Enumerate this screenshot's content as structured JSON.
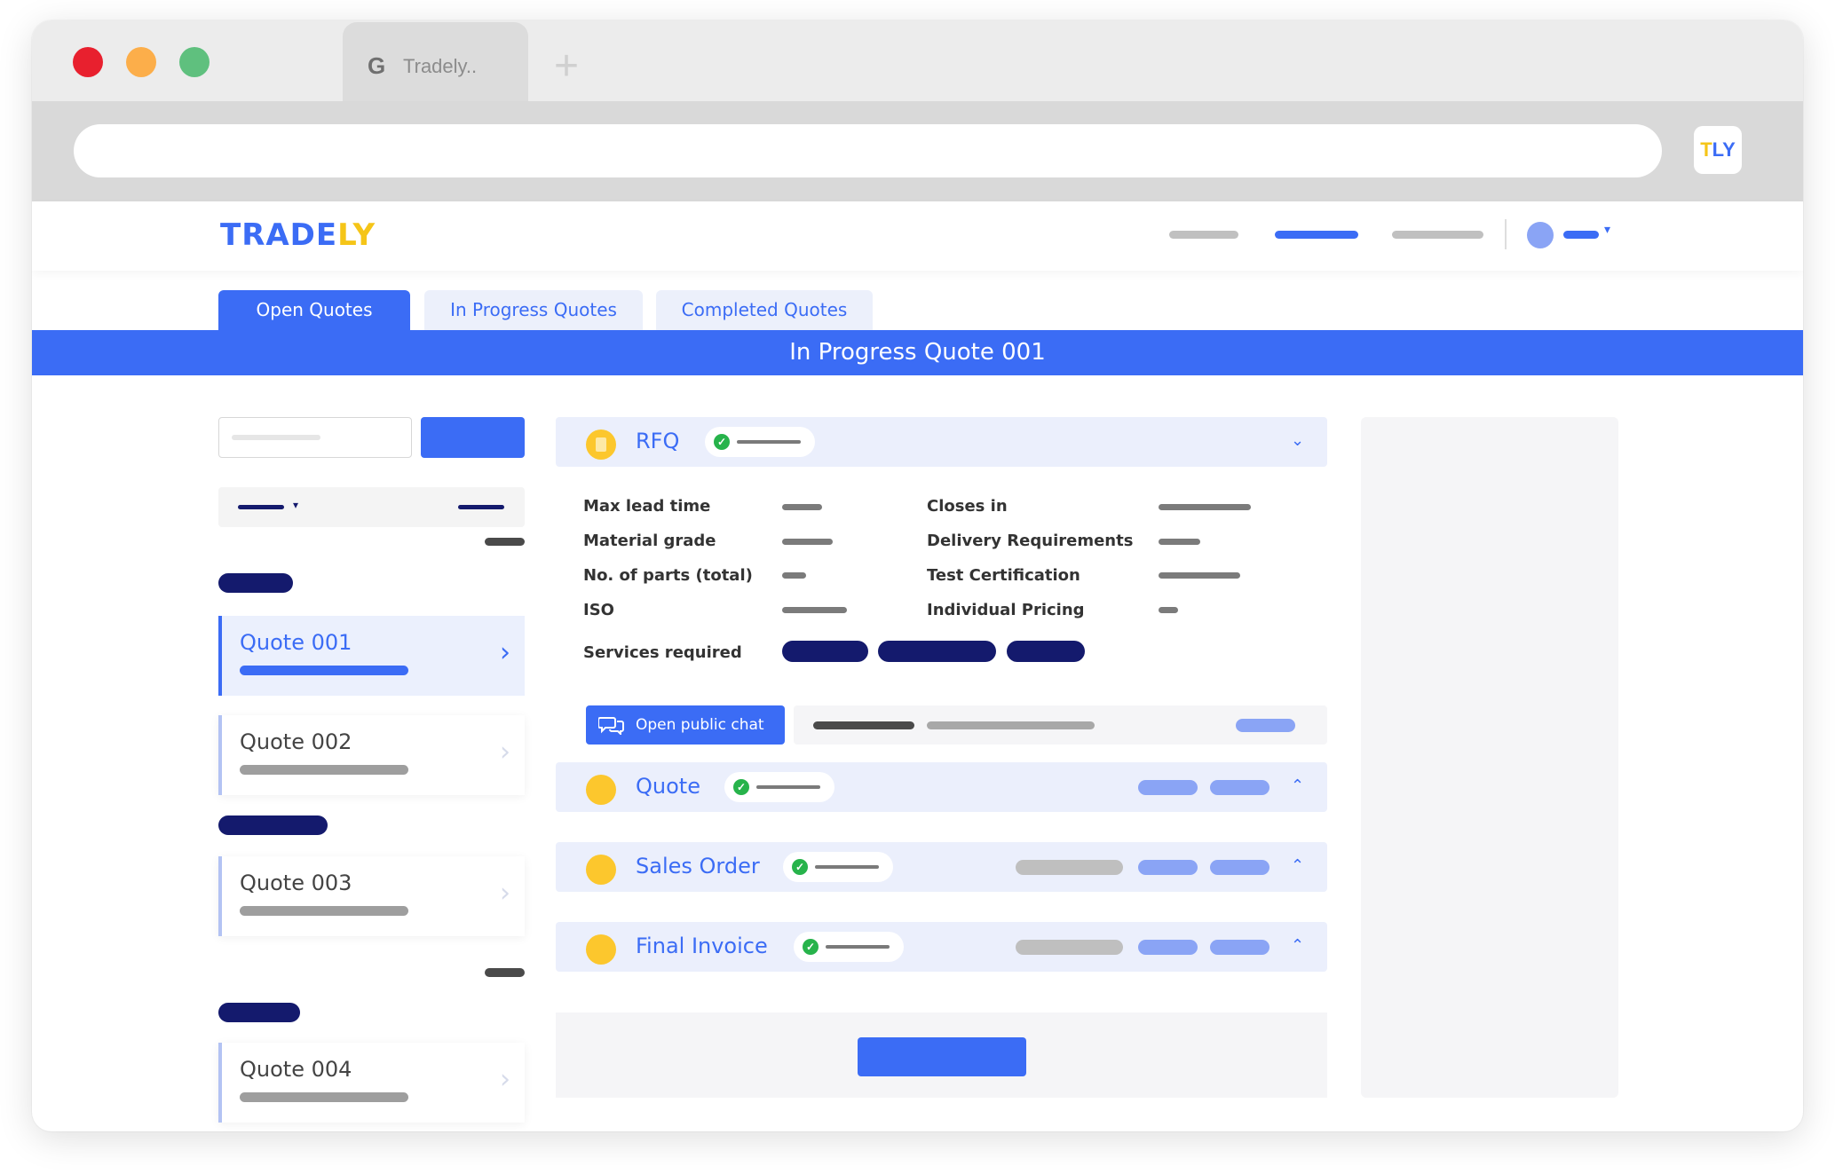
{
  "browser": {
    "tab_title": "Tradely..",
    "tab_favicon": "G",
    "new_tab_icon": "+",
    "extension_badge_t": "T",
    "extension_badge_rest": "LY",
    "traffic_lights": [
      "#e8202e",
      "#fcae4a",
      "#5fc07e"
    ]
  },
  "app": {
    "logo_main": "TRADE",
    "logo_accent": "LY",
    "brand_color": "#3b6cf5",
    "accent_color": "#f5c518"
  },
  "tabs": [
    {
      "label": "Open Quotes",
      "active": true
    },
    {
      "label": "In Progress Quotes",
      "active": false
    },
    {
      "label": "Completed Quotes",
      "active": false
    }
  ],
  "banner": {
    "title": "In Progress Quote 001"
  },
  "sidebar": {
    "quotes": [
      {
        "label": "Quote 001",
        "selected": true
      },
      {
        "label": "Quote 002",
        "selected": false
      },
      {
        "label": "Quote 003",
        "selected": false
      },
      {
        "label": "Quote 004",
        "selected": false
      }
    ]
  },
  "rfq": {
    "title": "RFQ",
    "details_left": [
      "Max lead time",
      "Material grade",
      "No. of parts (total)",
      "ISO"
    ],
    "details_right": [
      "Closes in",
      "Delivery Requirements",
      "Test Certification",
      "Individual Pricing"
    ],
    "services_label": "Services required",
    "chat_button": "Open public chat"
  },
  "sections": [
    {
      "title": "Quote"
    },
    {
      "title": "Sales Order"
    },
    {
      "title": "Final Invoice"
    }
  ],
  "icons": {
    "check": "✓",
    "chevron_right": "›",
    "chevron_down": "⌄",
    "chevron_up": "⌃",
    "caret_down": "▾"
  }
}
